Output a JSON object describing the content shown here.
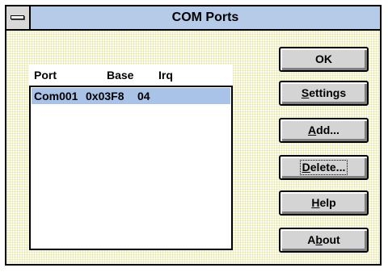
{
  "window": {
    "title": "COM Ports"
  },
  "list": {
    "columns": [
      "Port",
      "Base",
      "Irq"
    ],
    "rows": [
      {
        "port": "Com001",
        "base": "0x03F8",
        "irq": "04",
        "selected": true
      }
    ]
  },
  "buttons": {
    "ok": {
      "label": "OK"
    },
    "settings": {
      "mnemonic": "S",
      "rest": "ettings"
    },
    "add": {
      "mnemonic": "A",
      "rest": "dd..."
    },
    "delete": {
      "mnemonic": "D",
      "rest": "elete...",
      "focused": true
    },
    "help": {
      "mnemonic": "H",
      "rest": "elp"
    },
    "about": {
      "pre": "A",
      "mnemonic": "b",
      "rest": "out"
    }
  },
  "colors": {
    "title_bar": "#b5cbe8",
    "selection": "#a9c2e8",
    "button_face": "#d4d4d4",
    "dialog_pattern": "#e6e69e"
  }
}
